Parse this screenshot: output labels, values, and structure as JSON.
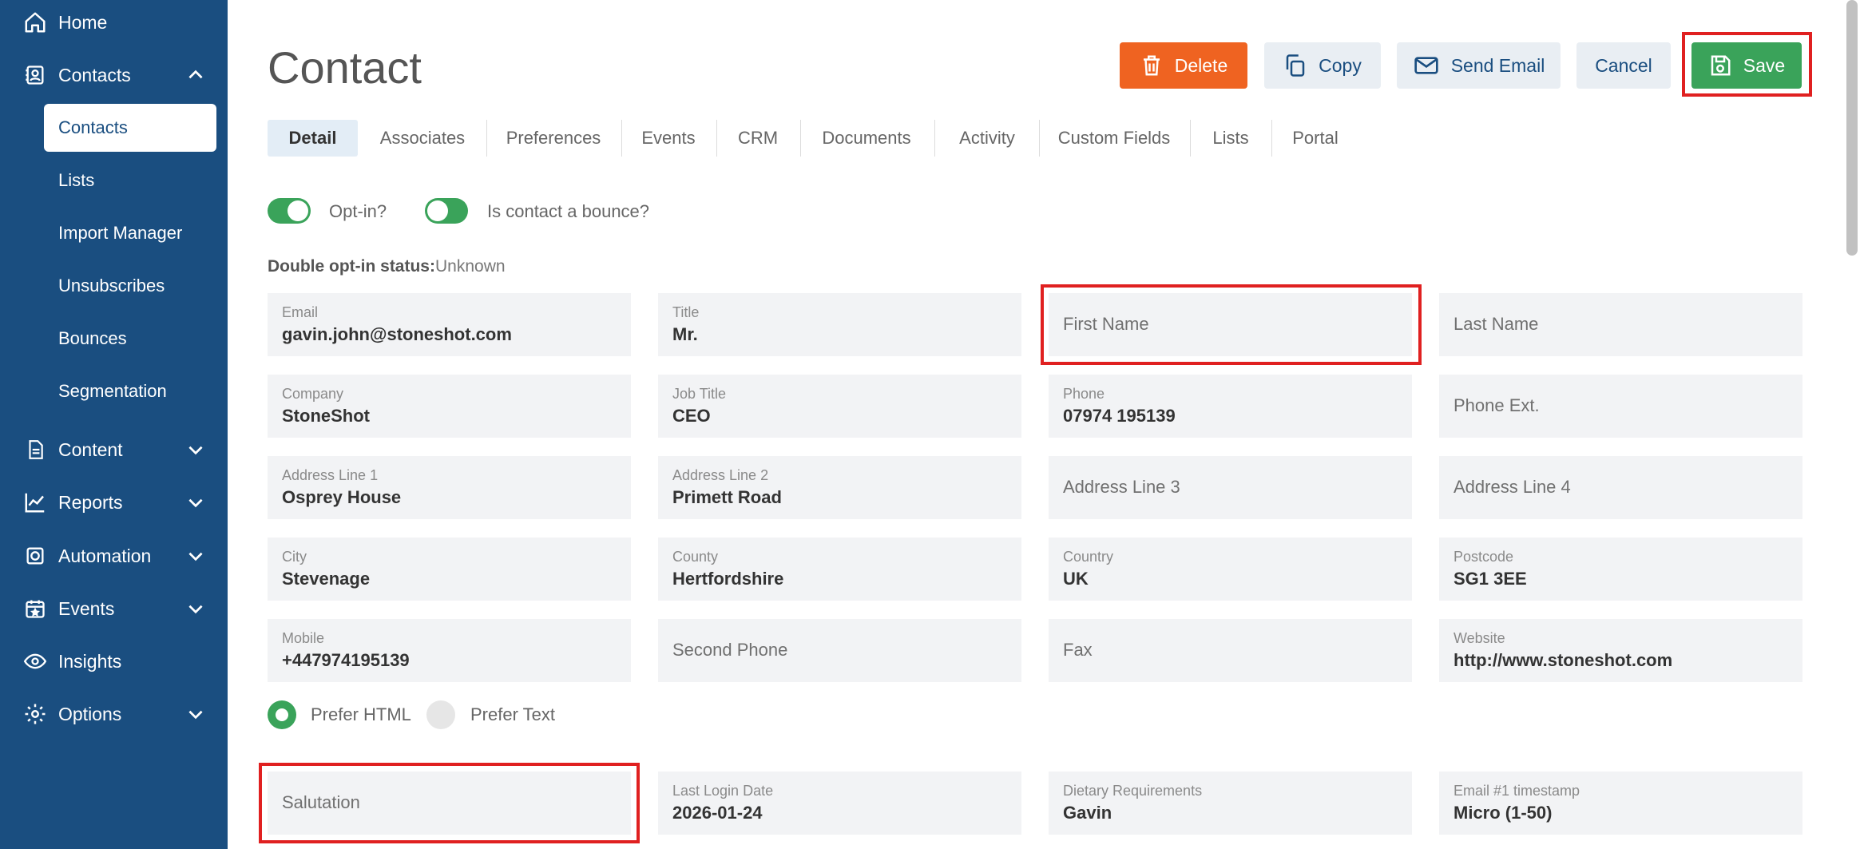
{
  "sidebar": {
    "home": "Home",
    "contacts": "Contacts",
    "contacts_sub": [
      "Contacts",
      "Lists",
      "Import Manager",
      "Unsubscribes",
      "Bounces",
      "Segmentation"
    ],
    "content": "Content",
    "reports": "Reports",
    "automation": "Automation",
    "events": "Events",
    "insights": "Insights",
    "options": "Options"
  },
  "header": {
    "title": "Contact",
    "delete": "Delete",
    "copy": "Copy",
    "send_email": "Send Email",
    "cancel": "Cancel",
    "save": "Save"
  },
  "tabs": [
    "Detail",
    "Associates",
    "Preferences",
    "Events",
    "CRM",
    "Documents",
    "Activity",
    "Custom Fields",
    "Lists",
    "Portal"
  ],
  "toggles": {
    "opt_in": "Opt-in?",
    "bounce": "Is contact a bounce?"
  },
  "double_optin": {
    "label": "Double opt-in status:",
    "value": "Unknown"
  },
  "fields": {
    "email": {
      "label": "Email",
      "value": "gavin.john@stoneshot.com"
    },
    "title": {
      "label": "Title",
      "value": "Mr."
    },
    "first_name": {
      "placeholder": "First Name"
    },
    "last_name": {
      "placeholder": "Last Name"
    },
    "company": {
      "label": "Company",
      "value": "StoneShot"
    },
    "job_title": {
      "label": "Job Title",
      "value": "CEO"
    },
    "phone": {
      "label": "Phone",
      "value": "07974 195139"
    },
    "phone_ext": {
      "placeholder": "Phone Ext."
    },
    "address1": {
      "label": "Address Line 1",
      "value": "Osprey House"
    },
    "address2": {
      "label": "Address Line 2",
      "value": "Primett Road"
    },
    "address3": {
      "placeholder": "Address Line 3"
    },
    "address4": {
      "placeholder": "Address Line 4"
    },
    "city": {
      "label": "City",
      "value": "Stevenage"
    },
    "county": {
      "label": "County",
      "value": "Hertfordshire"
    },
    "country": {
      "label": "Country",
      "value": "UK"
    },
    "postcode": {
      "label": "Postcode",
      "value": "SG1 3EE"
    },
    "mobile": {
      "label": "Mobile",
      "value": "+447974195139"
    },
    "second_phone": {
      "placeholder": "Second Phone"
    },
    "fax": {
      "placeholder": "Fax"
    },
    "website": {
      "label": "Website",
      "value": "http://www.stoneshot.com"
    },
    "salutation": {
      "placeholder": "Salutation"
    },
    "last_login": {
      "label": "Last Login Date",
      "value": "2026-01-24"
    },
    "dietary": {
      "label": "Dietary Requirements",
      "value": "Gavin"
    },
    "email_ts": {
      "label": "Email #1 timestamp",
      "value": "Micro (1-50)"
    }
  },
  "format": {
    "html": "Prefer HTML",
    "text": "Prefer Text"
  },
  "colors": {
    "sidebar": "#1a4e80",
    "delete": "#ef6321",
    "save": "#3aa35a",
    "highlight": "#e02020"
  }
}
